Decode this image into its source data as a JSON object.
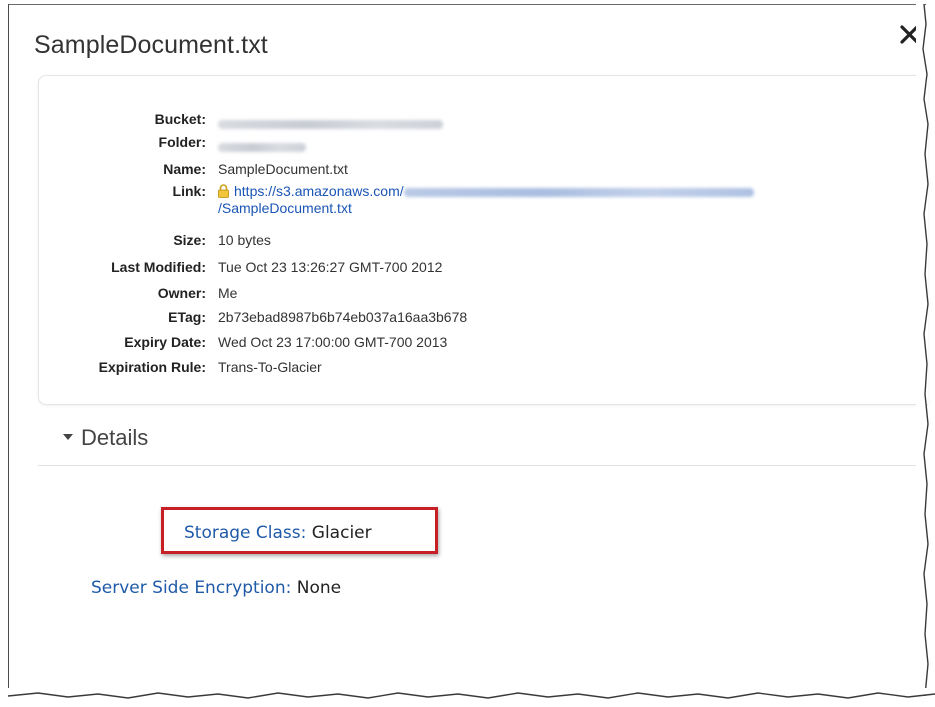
{
  "dialog": {
    "title": "SampleDocument.txt",
    "close_label": "✕"
  },
  "properties": [
    {
      "label": "Bucket:",
      "value": "",
      "redacted": true
    },
    {
      "label": "Folder:",
      "value": "",
      "redacted": true
    },
    {
      "label": "Name:",
      "value": "SampleDocument.txt"
    },
    {
      "label": "Link:",
      "value": "https://s3.amazonaws.com/",
      "value2": "/SampleDocument.txt",
      "is_link": true
    },
    {
      "label": "Size:",
      "value": "10 bytes"
    },
    {
      "label": "Last Modified:",
      "value": "Tue Oct 23 13:26:27 GMT-700 2012"
    },
    {
      "label": "Owner:",
      "value": "Me"
    },
    {
      "label": "ETag:",
      "value": "2b73ebad8987b6b74eb037a16aa3b678"
    },
    {
      "label": "Expiry Date:",
      "value": "Wed Oct 23 17:00:00 GMT-700 2013"
    },
    {
      "label": "Expiration Rule:",
      "value": "Trans-To-Glacier"
    }
  ],
  "details": {
    "header": "Details",
    "storage_class_key": "Storage Class:",
    "storage_class_value": "Glacier",
    "encryption_key": "Server Side Encryption:",
    "encryption_value": "None"
  },
  "icons": {
    "lock": "lock-icon",
    "close": "close-icon",
    "expand": "triangle-down-icon"
  },
  "colors": {
    "link": "#1a55b5",
    "highlight": "#c62026"
  }
}
